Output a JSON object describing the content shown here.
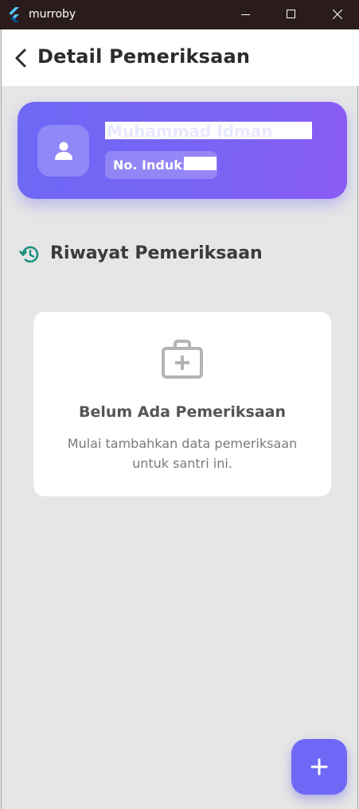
{
  "window": {
    "app_title": "murroby",
    "logo_icon": "flutter-logo-icon",
    "controls": {
      "minimize_icon": "minimize-icon",
      "maximize_icon": "maximize-icon",
      "close_icon": "close-icon"
    }
  },
  "appbar": {
    "back_icon": "chevron-left-icon",
    "title": "Detail Pemeriksaan"
  },
  "profile": {
    "avatar_icon": "person-icon",
    "name": "Muhammad Idman",
    "induk_label": "No. Induk:",
    "gradient_start": "#6d68f5",
    "gradient_end": "#8b5cf6"
  },
  "history": {
    "icon": "history-icon",
    "title": "Riwayat Pemeriksaan",
    "accent": "#1a9080"
  },
  "empty_state": {
    "icon": "medical-kit-icon",
    "title": "Belum Ada Pemeriksaan",
    "description": "Mulai tambahkan data pemeriksaan untuk santri ini."
  },
  "fab": {
    "icon": "plus-icon",
    "color": "#6d68f5"
  }
}
